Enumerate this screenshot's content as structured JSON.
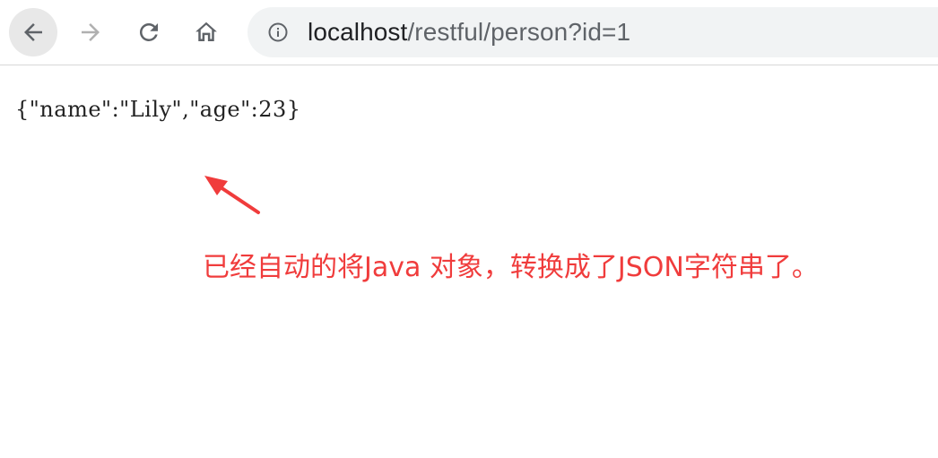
{
  "toolbar": {
    "back_icon": "arrow-left-icon",
    "forward_icon": "arrow-right-icon",
    "reload_icon": "reload-icon",
    "home_icon": "home-icon",
    "info_icon": "info-circle-icon"
  },
  "address_bar": {
    "host": "localhost",
    "path": "/restful/person?id=1"
  },
  "page": {
    "body_text": "{\"name\":\"Lily\",\"age\":23}"
  },
  "annotation": {
    "text": "已经自动的将Java  对象，转换成了JSON字符串了。",
    "color": "#f03c3c"
  }
}
